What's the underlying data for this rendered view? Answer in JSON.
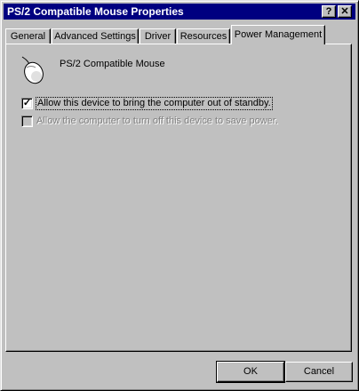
{
  "window": {
    "title": "PS/2 Compatible Mouse Properties",
    "help_label": "?",
    "close_label": "✕"
  },
  "tabs": [
    {
      "label": "General"
    },
    {
      "label": "Advanced Settings"
    },
    {
      "label": "Driver"
    },
    {
      "label": "Resources"
    },
    {
      "label": "Power Management",
      "active": true
    }
  ],
  "device": {
    "icon": "mouse-icon",
    "name": "PS/2 Compatible Mouse"
  },
  "options": [
    {
      "label": "Allow this device to bring the computer out of standby.",
      "checked": true,
      "enabled": true
    },
    {
      "label": "Allow the computer to turn off this device to save power.",
      "checked": false,
      "enabled": false
    }
  ],
  "buttons": {
    "ok": "OK",
    "cancel": "Cancel"
  }
}
